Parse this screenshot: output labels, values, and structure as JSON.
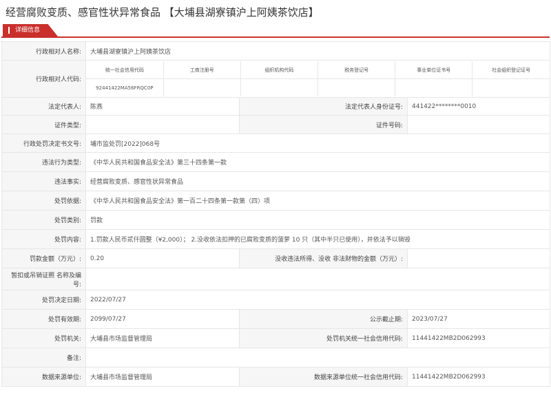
{
  "title": "经营腐败变质、感官性状异常食品 【大埔县湖寮镇沪上阿姨茶饮店】",
  "tab": {
    "label": "详细信息"
  },
  "rows": {
    "name": {
      "label": "行政相对人名称:",
      "value": "大埔县湖寮镇沪上阿姨茶饮店"
    },
    "code": {
      "label": "行政相对人代码:"
    },
    "legal_rep": {
      "label": "法定代表人:",
      "value": "陈燕",
      "label2": "法定代表人身份证号:",
      "value2": "441422********0010"
    },
    "cert_type": {
      "label": "证件类型:",
      "value": "",
      "label2": "证件号码:",
      "value2": ""
    },
    "doc_no": {
      "label": "行政处罚决定书文号:",
      "value": "埔市监处罚[2022]068号"
    },
    "violation_type": {
      "label": "违法行为类型:",
      "value": "《中华人民共和国食品安全法》第三十四条第一款"
    },
    "facts": {
      "label": "违法事实:",
      "value": "经营腐败变质、感官性状异常食品"
    },
    "basis": {
      "label": "处罚依据:",
      "value": "《中华人民共和国食品安全法》第一百二十四条第一款第（四）项"
    },
    "category": {
      "label": "处罚类别:",
      "value": "罚款"
    },
    "content": {
      "label": "处罚内容:",
      "value": "1.罚款人民币贰仟圆整（¥2,000）； 2.没收依法扣押的已腐败变质的菠萝 10 只（其中半只已使用），并依法予以销毁"
    },
    "amount": {
      "label": "罚款金额（万元）:",
      "value": "0.20",
      "label2": "没收违法所得、没收 非法财物的金额（万元）:",
      "value2": ""
    },
    "license": {
      "label": "暂扣或吊销证照 名称及编号:",
      "value": ""
    },
    "decision_date": {
      "label": "处罚决定日期:",
      "value": "2022/07/27"
    },
    "valid": {
      "label": "处罚有效期:",
      "value": "2099/07/27",
      "label2": "公示截止期:",
      "value2": "2023/07/27"
    },
    "authority": {
      "label": "处罚机关:",
      "value": "大埔县市场监督管理局",
      "label2": "处罚机关统一社会信用代码:",
      "value2": "11441422MB2D062993"
    },
    "remark": {
      "label": "备注:",
      "value": ""
    },
    "source": {
      "label": "数据来源单位:",
      "value": "大埔县市场监督管理局",
      "label2": "数据来源单位统一社会信用代码:",
      "value2": "11441422MB2D062993"
    }
  },
  "codes": {
    "headers": [
      "统一社会信用代码",
      "工商注册号",
      "组织机构代码",
      "税务登记号",
      "事业单位证书号",
      "社会组织登记证号"
    ],
    "values": [
      "92441422MA56FRQC0P",
      "",
      "",
      "",
      "",
      ""
    ]
  }
}
